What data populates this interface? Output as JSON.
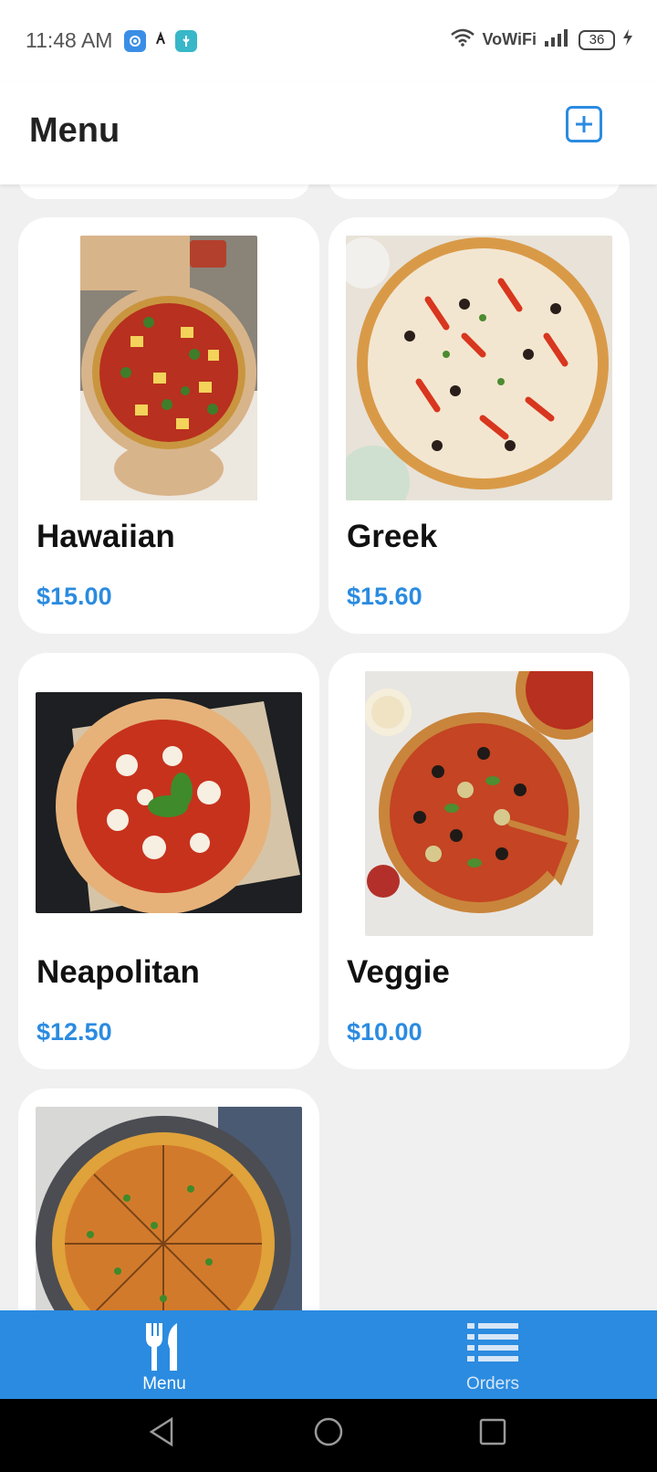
{
  "status_bar": {
    "time": "11:48 AM",
    "network": "VoWiFi",
    "battery": "36"
  },
  "header": {
    "title": "Menu"
  },
  "menu_items": [
    {
      "name": "Hawaiian",
      "price": "$15.00"
    },
    {
      "name": "Greek",
      "price": "$15.60"
    },
    {
      "name": "Neapolitan",
      "price": "$12.50"
    },
    {
      "name": "Veggie",
      "price": "$10.00"
    },
    {
      "name": "",
      "price": ""
    }
  ],
  "bottom_nav": {
    "items": [
      {
        "label": "Menu",
        "icon": "fork-knife-icon",
        "active": true
      },
      {
        "label": "Orders",
        "icon": "list-icon",
        "active": false
      }
    ]
  },
  "colors": {
    "accent": "#2b8be0",
    "nav_active_label": "#ffffff",
    "nav_inactive_label": "#d6e6f7"
  }
}
